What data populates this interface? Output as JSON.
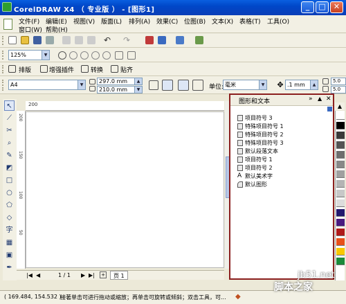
{
  "window": {
    "title": "CorelDRAW X4 （ 专业版 ） - [图形1]"
  },
  "menu": [
    "文件(F)",
    "编辑(E)",
    "视图(V)",
    "版面(L)",
    "排列(A)",
    "效果(C)",
    "位图(B)",
    "文本(X)",
    "表格(T)",
    "工具(O)",
    "窗口(W)",
    "帮助(H)"
  ],
  "toolbar": {
    "zoom": "125%"
  },
  "textbar": {
    "layout": "排版",
    "plugins": "增强插件",
    "convert": "转换",
    "paste": "贴齐"
  },
  "property_bar": {
    "page_size": "A4",
    "width": "297.0 mm",
    "height": "210.0 mm",
    "units_label": "单位:",
    "units": "毫米",
    "nudge": ".1 mm",
    "dup1": "5.0",
    "dup2": "5.0"
  },
  "docker": {
    "title": "图形和文本",
    "items": [
      "项目符号 3",
      "特殊项目符号 1",
      "特殊项目符号 2",
      "特殊项目符号 3",
      "默认段落文本",
      "项目符号 1",
      "项目符号 2",
      "默认美术字",
      "默认图形"
    ]
  },
  "ruler": {
    "h_label": "200",
    "v1": "200",
    "v2": "150",
    "v3": "100",
    "v4": "50"
  },
  "pages": {
    "counter": "1 / 1",
    "tab": "页 1"
  },
  "status": {
    "coords": "( 169.484, 154.532 )",
    "hint": "接著单击可进行拖动或缩放；再单击可旋转或倾斜；双击工具，可..."
  },
  "palette_colors": [
    "#ffffff",
    "#000000",
    "#3a3a3a",
    "#545454",
    "#6e6e6e",
    "#888888",
    "#a0a0a0",
    "#b4b4b4",
    "#c8c8c8",
    "#dcdcdc",
    "#22186e",
    "#4a1a80",
    "#b01a1a",
    "#e8501a",
    "#f8c800",
    "#1a8a3a"
  ],
  "watermark": {
    "domain": "jb51.net",
    "name": "脚本之家"
  }
}
